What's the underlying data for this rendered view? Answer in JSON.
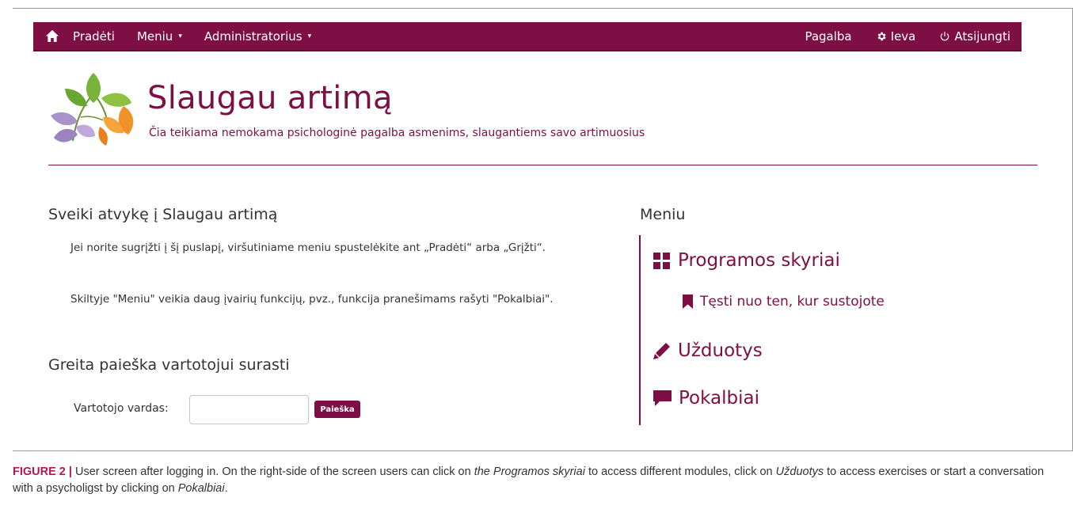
{
  "navbar": {
    "home_icon": "home-icon",
    "left_items": [
      {
        "label": "Pradėti",
        "caret": ""
      },
      {
        "label": "Meniu",
        "caret": "▾"
      },
      {
        "label": "Administratorius",
        "caret": "▾"
      }
    ],
    "help_label": "Pagalba",
    "user_label": "Ieva",
    "user_icon": "gear-icon",
    "logout_label": "Atsijungti",
    "logout_icon": "power-icon"
  },
  "header": {
    "title": "Slaugau artimą",
    "subtitle": "Čia teikiama nemokama psichologinė pagalba asmenims, slaugantiems savo artimuosius"
  },
  "welcome": {
    "heading": "Sveiki atvykę į Slaugau artimą",
    "paragraph1": "Jei norite sugrįžti į šį puslapį, viršutiniame meniu spustelėkite ant „Pradėti“ arba „Grįžti“.",
    "paragraph2": "Skiltyje \"Meniu\" veikia daug įvairių funkcijų, pvz., funkcija pranešimams rašyti \"Pokalbiai\"."
  },
  "search": {
    "heading": "Greita paieška vartotojui surasti",
    "label": "Vartotojo vardas:",
    "value": "",
    "button_label": "Paieška"
  },
  "menu": {
    "heading": "Meniu",
    "items": [
      {
        "label": "Programos skyriai",
        "icon": "grid-icon"
      },
      {
        "label": "Tęsti nuo ten, kur sustojote",
        "icon": "bookmark-icon"
      },
      {
        "label": "Užduotys",
        "icon": "pencil-icon"
      },
      {
        "label": "Pokalbiai",
        "icon": "chat-icon"
      }
    ]
  },
  "caption": {
    "label": "FIGURE 2 |",
    "text_1": " User screen after logging in. On the right-side of the screen users can click on ",
    "em_1": "the Programos skyriai",
    "text_2": " to access different modules, click on ",
    "em_2": "Užduotys",
    "text_3": " to access exercises or start a conversation with a psycholigst by clicking on ",
    "em_3": "Pokalbiai",
    "text_4": "."
  },
  "colors": {
    "brand": "#7e0f45",
    "caption_label": "#b3174f"
  }
}
